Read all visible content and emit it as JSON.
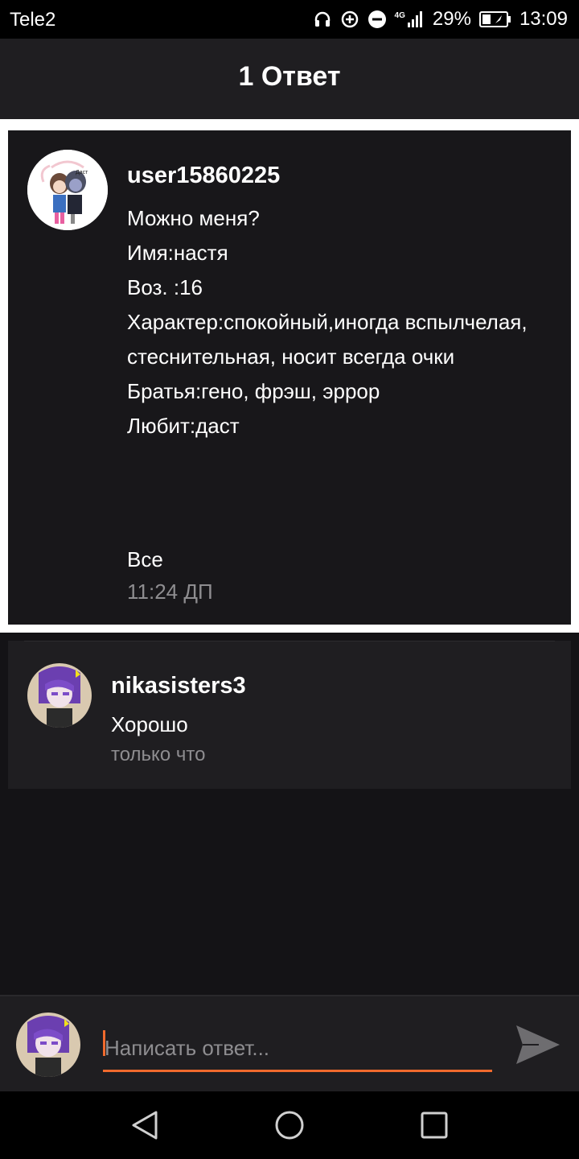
{
  "status_bar": {
    "carrier": "Tele2",
    "network": "4G",
    "battery": "29%",
    "time": "13:09",
    "icons": [
      "headphones-icon",
      "data-saver-icon",
      "dnd-icon",
      "signal-icon",
      "battery-icon"
    ]
  },
  "header": {
    "title": "1 Ответ"
  },
  "post": {
    "username": "user15860225",
    "avatar_text": "Даст",
    "lines": [
      "Можно меня?",
      "Имя:настя",
      "Воз. :16",
      "Характер:спокойный,иногда вспылчелая, стеснительная, носит всегда очки",
      "Братья:гено, фрэш, эррор",
      "Любит:даст"
    ],
    "tail": "Все",
    "time": "11:24 ДП"
  },
  "reply": {
    "username": "nikasisters3",
    "text": "Хорошо",
    "time": "только что"
  },
  "composer": {
    "placeholder": "Написать ответ..."
  },
  "colors": {
    "accent": "#f06a2d",
    "background": "#141316",
    "card": "#1f1e21",
    "muted": "#8e8d90"
  }
}
